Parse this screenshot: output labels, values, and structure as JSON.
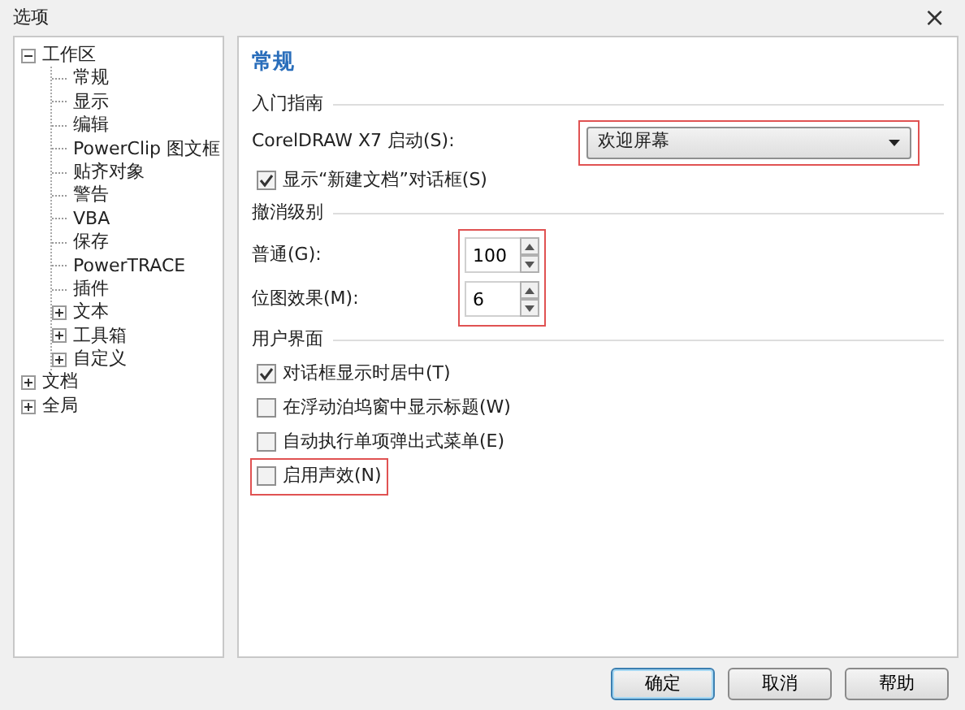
{
  "window": {
    "title": "选项",
    "close": "×"
  },
  "tree": [
    {
      "label": "工作区",
      "expanded": true,
      "children": [
        {
          "label": "常规"
        },
        {
          "label": "显示"
        },
        {
          "label": "编辑"
        },
        {
          "label": "PowerClip 图文框"
        },
        {
          "label": "贴齐对象"
        },
        {
          "label": "警告"
        },
        {
          "label": "VBA"
        },
        {
          "label": "保存"
        },
        {
          "label": "PowerTRACE"
        },
        {
          "label": "插件"
        },
        {
          "label": "文本",
          "expanded": false
        },
        {
          "label": "工具箱",
          "expanded": false
        },
        {
          "label": "自定义",
          "expanded": false
        }
      ]
    },
    {
      "label": "文档",
      "expanded": false
    },
    {
      "label": "全局",
      "expanded": false
    }
  ],
  "page": {
    "heading": "常规",
    "sections": [
      {
        "title": "入门指南",
        "items": [
          {
            "kind": "dropdown",
            "label": "CorelDRAW X7 启动(S):",
            "value": "欢迎屏幕",
            "highlighted": true
          },
          {
            "kind": "checkbox",
            "label": "显示“新建文档”对话框(S)",
            "checked": true,
            "highlighted": false
          }
        ]
      },
      {
        "title": "撤消级别",
        "items": [
          {
            "kind": "spin-group",
            "highlighted": true,
            "fields": [
              {
                "label": "普通(G):",
                "value": "100"
              },
              {
                "label": "位图效果(M):",
                "value": "6"
              }
            ]
          }
        ]
      },
      {
        "title": "用户界面",
        "items": [
          {
            "kind": "checkbox",
            "label": "对话框显示时居中(T)",
            "checked": true,
            "highlighted": false
          },
          {
            "kind": "checkbox",
            "label": "在浮动泊坞窗中显示标题(W)",
            "checked": false,
            "highlighted": false
          },
          {
            "kind": "checkbox",
            "label": "自动执行单项弹出式菜单(E)",
            "checked": false,
            "highlighted": false
          },
          {
            "kind": "checkbox",
            "label": "启用声效(N)",
            "checked": false,
            "highlighted": true
          }
        ]
      }
    ]
  },
  "buttons": [
    {
      "label": "确定",
      "default": true
    },
    {
      "label": "取消",
      "default": false
    },
    {
      "label": "帮助",
      "default": false
    }
  ]
}
